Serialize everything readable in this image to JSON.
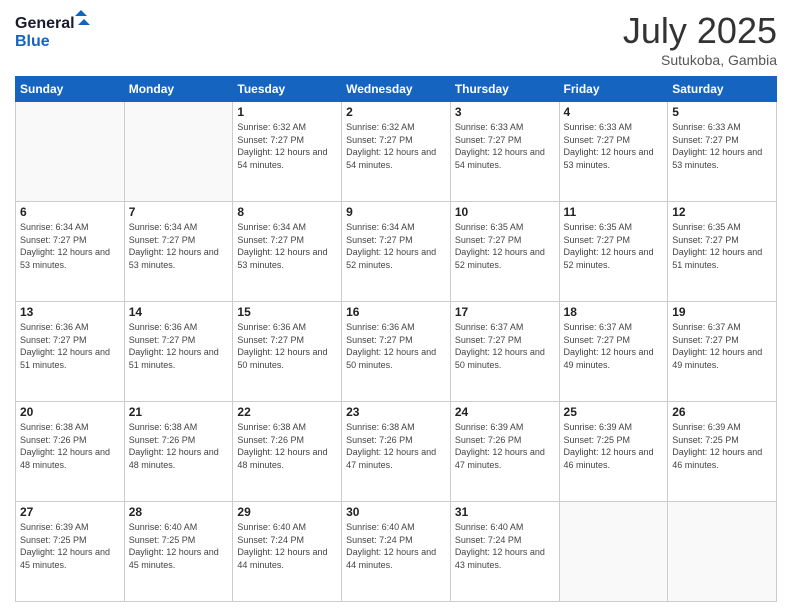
{
  "logo": {
    "line1": "General",
    "line2": "Blue"
  },
  "header": {
    "month": "July 2025",
    "location": "Sutukoba, Gambia"
  },
  "weekdays": [
    "Sunday",
    "Monday",
    "Tuesday",
    "Wednesday",
    "Thursday",
    "Friday",
    "Saturday"
  ],
  "weeks": [
    [
      {
        "day": "",
        "info": ""
      },
      {
        "day": "",
        "info": ""
      },
      {
        "day": "1",
        "info": "Sunrise: 6:32 AM\nSunset: 7:27 PM\nDaylight: 12 hours and 54 minutes."
      },
      {
        "day": "2",
        "info": "Sunrise: 6:32 AM\nSunset: 7:27 PM\nDaylight: 12 hours and 54 minutes."
      },
      {
        "day": "3",
        "info": "Sunrise: 6:33 AM\nSunset: 7:27 PM\nDaylight: 12 hours and 54 minutes."
      },
      {
        "day": "4",
        "info": "Sunrise: 6:33 AM\nSunset: 7:27 PM\nDaylight: 12 hours and 53 minutes."
      },
      {
        "day": "5",
        "info": "Sunrise: 6:33 AM\nSunset: 7:27 PM\nDaylight: 12 hours and 53 minutes."
      }
    ],
    [
      {
        "day": "6",
        "info": "Sunrise: 6:34 AM\nSunset: 7:27 PM\nDaylight: 12 hours and 53 minutes."
      },
      {
        "day": "7",
        "info": "Sunrise: 6:34 AM\nSunset: 7:27 PM\nDaylight: 12 hours and 53 minutes."
      },
      {
        "day": "8",
        "info": "Sunrise: 6:34 AM\nSunset: 7:27 PM\nDaylight: 12 hours and 53 minutes."
      },
      {
        "day": "9",
        "info": "Sunrise: 6:34 AM\nSunset: 7:27 PM\nDaylight: 12 hours and 52 minutes."
      },
      {
        "day": "10",
        "info": "Sunrise: 6:35 AM\nSunset: 7:27 PM\nDaylight: 12 hours and 52 minutes."
      },
      {
        "day": "11",
        "info": "Sunrise: 6:35 AM\nSunset: 7:27 PM\nDaylight: 12 hours and 52 minutes."
      },
      {
        "day": "12",
        "info": "Sunrise: 6:35 AM\nSunset: 7:27 PM\nDaylight: 12 hours and 51 minutes."
      }
    ],
    [
      {
        "day": "13",
        "info": "Sunrise: 6:36 AM\nSunset: 7:27 PM\nDaylight: 12 hours and 51 minutes."
      },
      {
        "day": "14",
        "info": "Sunrise: 6:36 AM\nSunset: 7:27 PM\nDaylight: 12 hours and 51 minutes."
      },
      {
        "day": "15",
        "info": "Sunrise: 6:36 AM\nSunset: 7:27 PM\nDaylight: 12 hours and 50 minutes."
      },
      {
        "day": "16",
        "info": "Sunrise: 6:36 AM\nSunset: 7:27 PM\nDaylight: 12 hours and 50 minutes."
      },
      {
        "day": "17",
        "info": "Sunrise: 6:37 AM\nSunset: 7:27 PM\nDaylight: 12 hours and 50 minutes."
      },
      {
        "day": "18",
        "info": "Sunrise: 6:37 AM\nSunset: 7:27 PM\nDaylight: 12 hours and 49 minutes."
      },
      {
        "day": "19",
        "info": "Sunrise: 6:37 AM\nSunset: 7:27 PM\nDaylight: 12 hours and 49 minutes."
      }
    ],
    [
      {
        "day": "20",
        "info": "Sunrise: 6:38 AM\nSunset: 7:26 PM\nDaylight: 12 hours and 48 minutes."
      },
      {
        "day": "21",
        "info": "Sunrise: 6:38 AM\nSunset: 7:26 PM\nDaylight: 12 hours and 48 minutes."
      },
      {
        "day": "22",
        "info": "Sunrise: 6:38 AM\nSunset: 7:26 PM\nDaylight: 12 hours and 48 minutes."
      },
      {
        "day": "23",
        "info": "Sunrise: 6:38 AM\nSunset: 7:26 PM\nDaylight: 12 hours and 47 minutes."
      },
      {
        "day": "24",
        "info": "Sunrise: 6:39 AM\nSunset: 7:26 PM\nDaylight: 12 hours and 47 minutes."
      },
      {
        "day": "25",
        "info": "Sunrise: 6:39 AM\nSunset: 7:25 PM\nDaylight: 12 hours and 46 minutes."
      },
      {
        "day": "26",
        "info": "Sunrise: 6:39 AM\nSunset: 7:25 PM\nDaylight: 12 hours and 46 minutes."
      }
    ],
    [
      {
        "day": "27",
        "info": "Sunrise: 6:39 AM\nSunset: 7:25 PM\nDaylight: 12 hours and 45 minutes."
      },
      {
        "day": "28",
        "info": "Sunrise: 6:40 AM\nSunset: 7:25 PM\nDaylight: 12 hours and 45 minutes."
      },
      {
        "day": "29",
        "info": "Sunrise: 6:40 AM\nSunset: 7:24 PM\nDaylight: 12 hours and 44 minutes."
      },
      {
        "day": "30",
        "info": "Sunrise: 6:40 AM\nSunset: 7:24 PM\nDaylight: 12 hours and 44 minutes."
      },
      {
        "day": "31",
        "info": "Sunrise: 6:40 AM\nSunset: 7:24 PM\nDaylight: 12 hours and 43 minutes."
      },
      {
        "day": "",
        "info": ""
      },
      {
        "day": "",
        "info": ""
      }
    ]
  ]
}
